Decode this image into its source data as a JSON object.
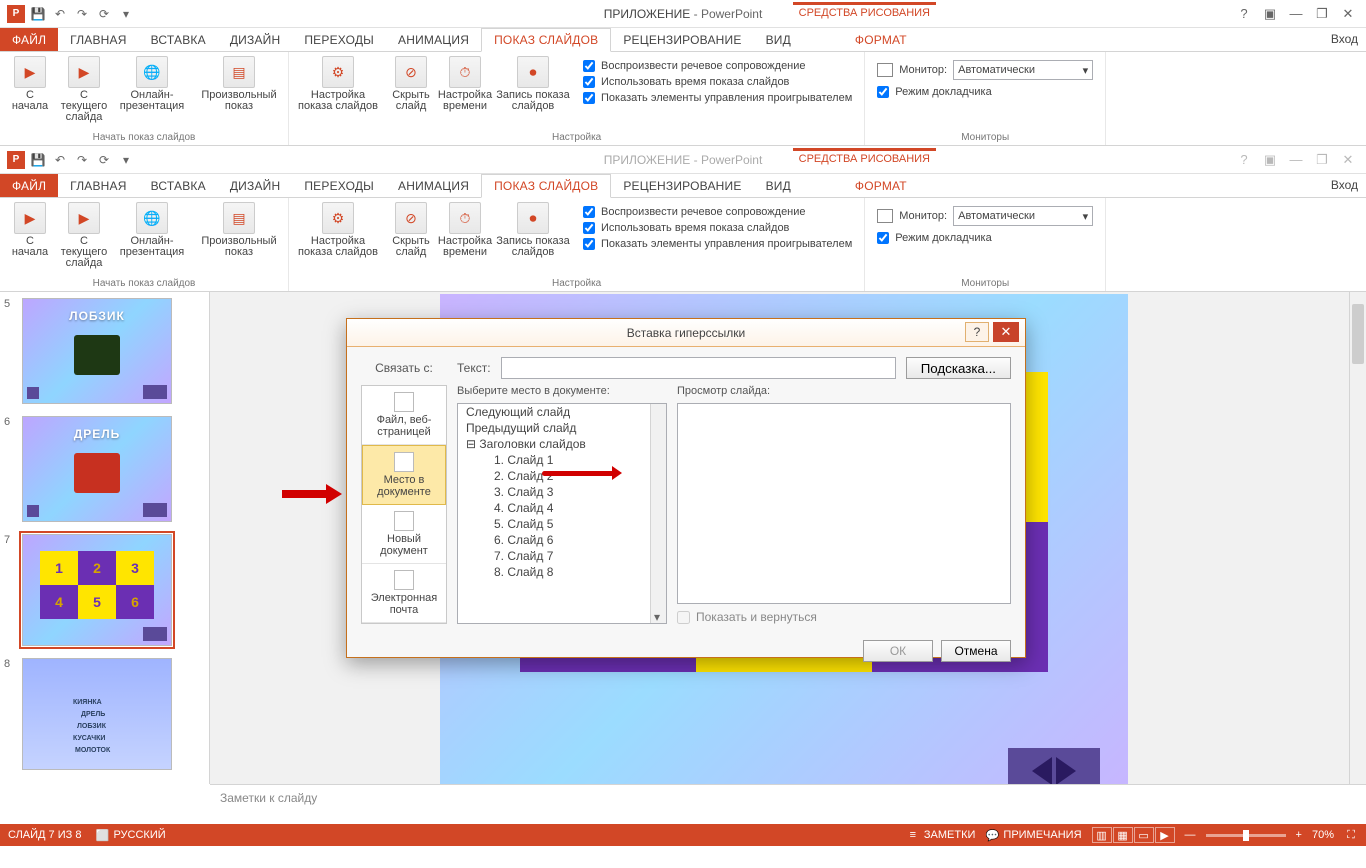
{
  "app": {
    "doc": "ПРИЛОЖЕНИЕ",
    "name": " - PowerPoint",
    "tools_context": "СРЕДСТВА РИСОВАНИЯ",
    "login": "Вход"
  },
  "tabs": {
    "file": "ФАЙЛ",
    "home": "ГЛАВНАЯ",
    "insert": "ВСТАВКА",
    "design": "ДИЗАЙН",
    "transitions": "ПЕРЕХОДЫ",
    "animations": "АНИМАЦИЯ",
    "slideshow": "ПОКАЗ СЛАЙДОВ",
    "review": "РЕЦЕНЗИРОВАНИЕ",
    "view": "ВИД",
    "format": "ФОРМАТ"
  },
  "ribbon": {
    "from_start": "С\nначала",
    "from_current": "С текущего\nслайда",
    "online": "Онлайн-\nпрезентация",
    "custom": "Произвольный\nпоказ",
    "setup": "Настройка\nпоказа слайдов",
    "hide": "Скрыть\nслайд",
    "timing": "Настройка\nвремени",
    "record": "Запись показа\nслайдов",
    "chk1": "Воспроизвести речевое сопровождение",
    "chk2": "Использовать время показа слайдов",
    "chk3": "Показать элементы управления проигрывателем",
    "monitor_label": "Монитор:",
    "monitor_value": "Автоматически",
    "presenter": "Режим докладчика",
    "grp_start": "Начать показ слайдов",
    "grp_setup": "Настройка",
    "grp_monitors": "Мониторы"
  },
  "thumbs": {
    "n5": "5",
    "t5": "ЛОБЗИК",
    "n6": "6",
    "t6": "ДРЕЛЬ",
    "n7": "7",
    "n8": "8",
    "g1": "1",
    "g2": "2",
    "g3": "3",
    "g4": "4",
    "g5": "5",
    "g6": "6",
    "tool1": "КИЯНКА",
    "tool2": "ДРЕЛЬ",
    "tool3": "ЛОБЗИК",
    "tool4": "КУСАЧКИ",
    "tool5": "МОЛОТОК"
  },
  "notes": "Заметки к слайду",
  "status": {
    "slide": "СЛАЙД 7 ИЗ 8",
    "lang": "РУССКИЙ",
    "notes_btn": "ЗАМЕТКИ",
    "comments_btn": "ПРИМЕЧАНИЯ",
    "zoom": "70%"
  },
  "dialog": {
    "title": "Вставка гиперссылки",
    "link_to": "Связать с:",
    "text_label": "Текст:",
    "hint_btn": "Подсказка...",
    "place_label": "Выберите место в документе:",
    "preview_label": "Просмотр слайда:",
    "show_return": "Показать и вернуться",
    "ok": "ОК",
    "cancel": "Отмена",
    "lt": {
      "file": "Файл, веб-\nстраницей",
      "place": "Место в\nдокументе",
      "newdoc": "Новый\nдокумент",
      "email": "Электронная\nпочта"
    },
    "tree": {
      "next": "Следующий слайд",
      "prev": "Предыдущий слайд",
      "heads": "Заголовки слайдов",
      "s1": "1. Слайд 1",
      "s2": "2. Слайд 2",
      "s3": "3. Слайд 3",
      "s4": "4. Слайд 4",
      "s5": "5. Слайд 5",
      "s6": "6. Слайд 6",
      "s7": "7. Слайд 7",
      "s8": "8. Слайд 8"
    }
  }
}
